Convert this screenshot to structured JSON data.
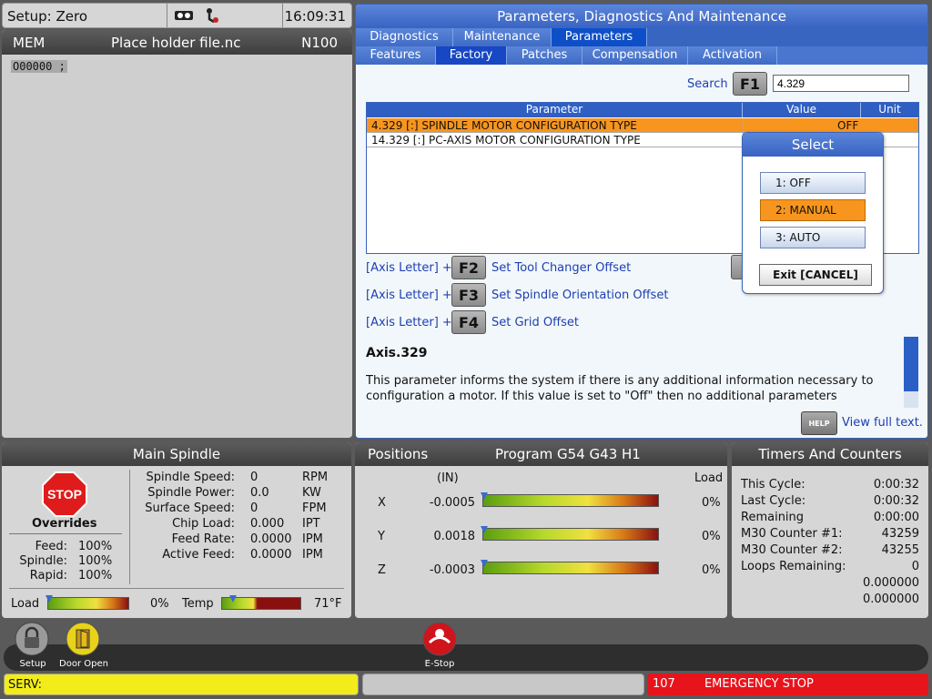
{
  "topbar": {
    "setup": "Setup: Zero",
    "clock": "16:09:31"
  },
  "program": {
    "mode": "MEM",
    "filename": "Place holder file.nc",
    "nline": "N100",
    "code_line": "O00000 ;"
  },
  "params": {
    "title": "Parameters, Diagnostics And Maintenance",
    "tabs1": [
      "Diagnostics",
      "Maintenance",
      "Parameters"
    ],
    "tabs2": [
      "Features",
      "Factory",
      "Patches",
      "Compensation",
      "Activation"
    ],
    "search_label": "Search",
    "f1": "F1",
    "search_value": "4.329",
    "columns": [
      "Parameter",
      "Value",
      "Unit"
    ],
    "rows": [
      {
        "name": "4.329 [:] SPINDLE MOTOR CONFIGURATION TYPE",
        "value": "OFF",
        "unit": ""
      },
      {
        "name": "14.329 [:] PC-AXIS MOTOR CONFIGURATION TYPE",
        "value": "",
        "unit": ""
      }
    ],
    "axis_label": "[Axis Letter] +",
    "actions": [
      {
        "key": "F2",
        "desc": "Set Tool Changer Offset"
      },
      {
        "key": "F3",
        "desc": "Set Spindle Orientation Offset"
      },
      {
        "key": "F4",
        "desc": "Set Grid Offset"
      }
    ],
    "help_title": "Axis.329",
    "help_body": "This parameter informs the system if there is any additional information necessary to configuration a motor. If this value is set to \"Off\" then no additional parameters",
    "help_btn": "HELP",
    "view_full": "View full text."
  },
  "select": {
    "title": "Select",
    "options": [
      "1: OFF",
      "2: MANUAL",
      "3: AUTO"
    ],
    "selected_index": 1,
    "exit": "Exit  [CANCEL]"
  },
  "spindle": {
    "title": "Main Spindle",
    "stop": "STOP",
    "overrides": "Overrides",
    "override_rows": [
      {
        "k": "Feed:",
        "v": "100%"
      },
      {
        "k": "Spindle:",
        "v": "100%"
      },
      {
        "k": "Rapid:",
        "v": "100%"
      }
    ],
    "stats": [
      {
        "k": "Spindle Speed:",
        "v": "0",
        "u": "RPM"
      },
      {
        "k": "Spindle Power:",
        "v": "0.0",
        "u": "KW"
      },
      {
        "k": "Surface Speed:",
        "v": "0",
        "u": "FPM"
      },
      {
        "k": "Chip Load:",
        "v": "0.000",
        "u": "IPT"
      },
      {
        "k": "Feed Rate:",
        "v": "0.0000",
        "u": "IPM"
      },
      {
        "k": "Active Feed:",
        "v": "0.0000",
        "u": "IPM"
      }
    ],
    "load_label": "Load",
    "load_value": "0%",
    "temp_label": "Temp",
    "temp_value": "71°F"
  },
  "positions": {
    "title": "Positions",
    "program": "Program G54 G43 H1",
    "unit": "(IN)",
    "load_header": "Load",
    "axes": [
      {
        "axis": "X",
        "value": "-0.0005",
        "load": "0%"
      },
      {
        "axis": "Y",
        "value": "0.0018",
        "load": "0%"
      },
      {
        "axis": "Z",
        "value": "-0.0003",
        "load": "0%"
      }
    ]
  },
  "timers": {
    "title": "Timers And Counters",
    "rows": [
      {
        "k": "This Cycle:",
        "v": "0:00:32"
      },
      {
        "k": "Last Cycle:",
        "v": "0:00:32"
      },
      {
        "k": "Remaining",
        "v": "0:00:00"
      },
      {
        "k": "M30 Counter #1:",
        "v": "43259"
      },
      {
        "k": "M30 Counter #2:",
        "v": "43255"
      },
      {
        "k": "Loops Remaining:",
        "v": "0"
      },
      {
        "k": "",
        "v": "0.000000"
      },
      {
        "k": "",
        "v": "0.000000"
      }
    ]
  },
  "controls": {
    "setup": "Setup",
    "door": "Door Open",
    "estop": "E-Stop"
  },
  "status": {
    "left": "SERV:",
    "code": "107",
    "message": "EMERGENCY STOP"
  },
  "colors": {
    "accent": "#3963c2",
    "selected": "#f7951e",
    "alarm": "#e8141c",
    "serv": "#f2ec1a"
  }
}
